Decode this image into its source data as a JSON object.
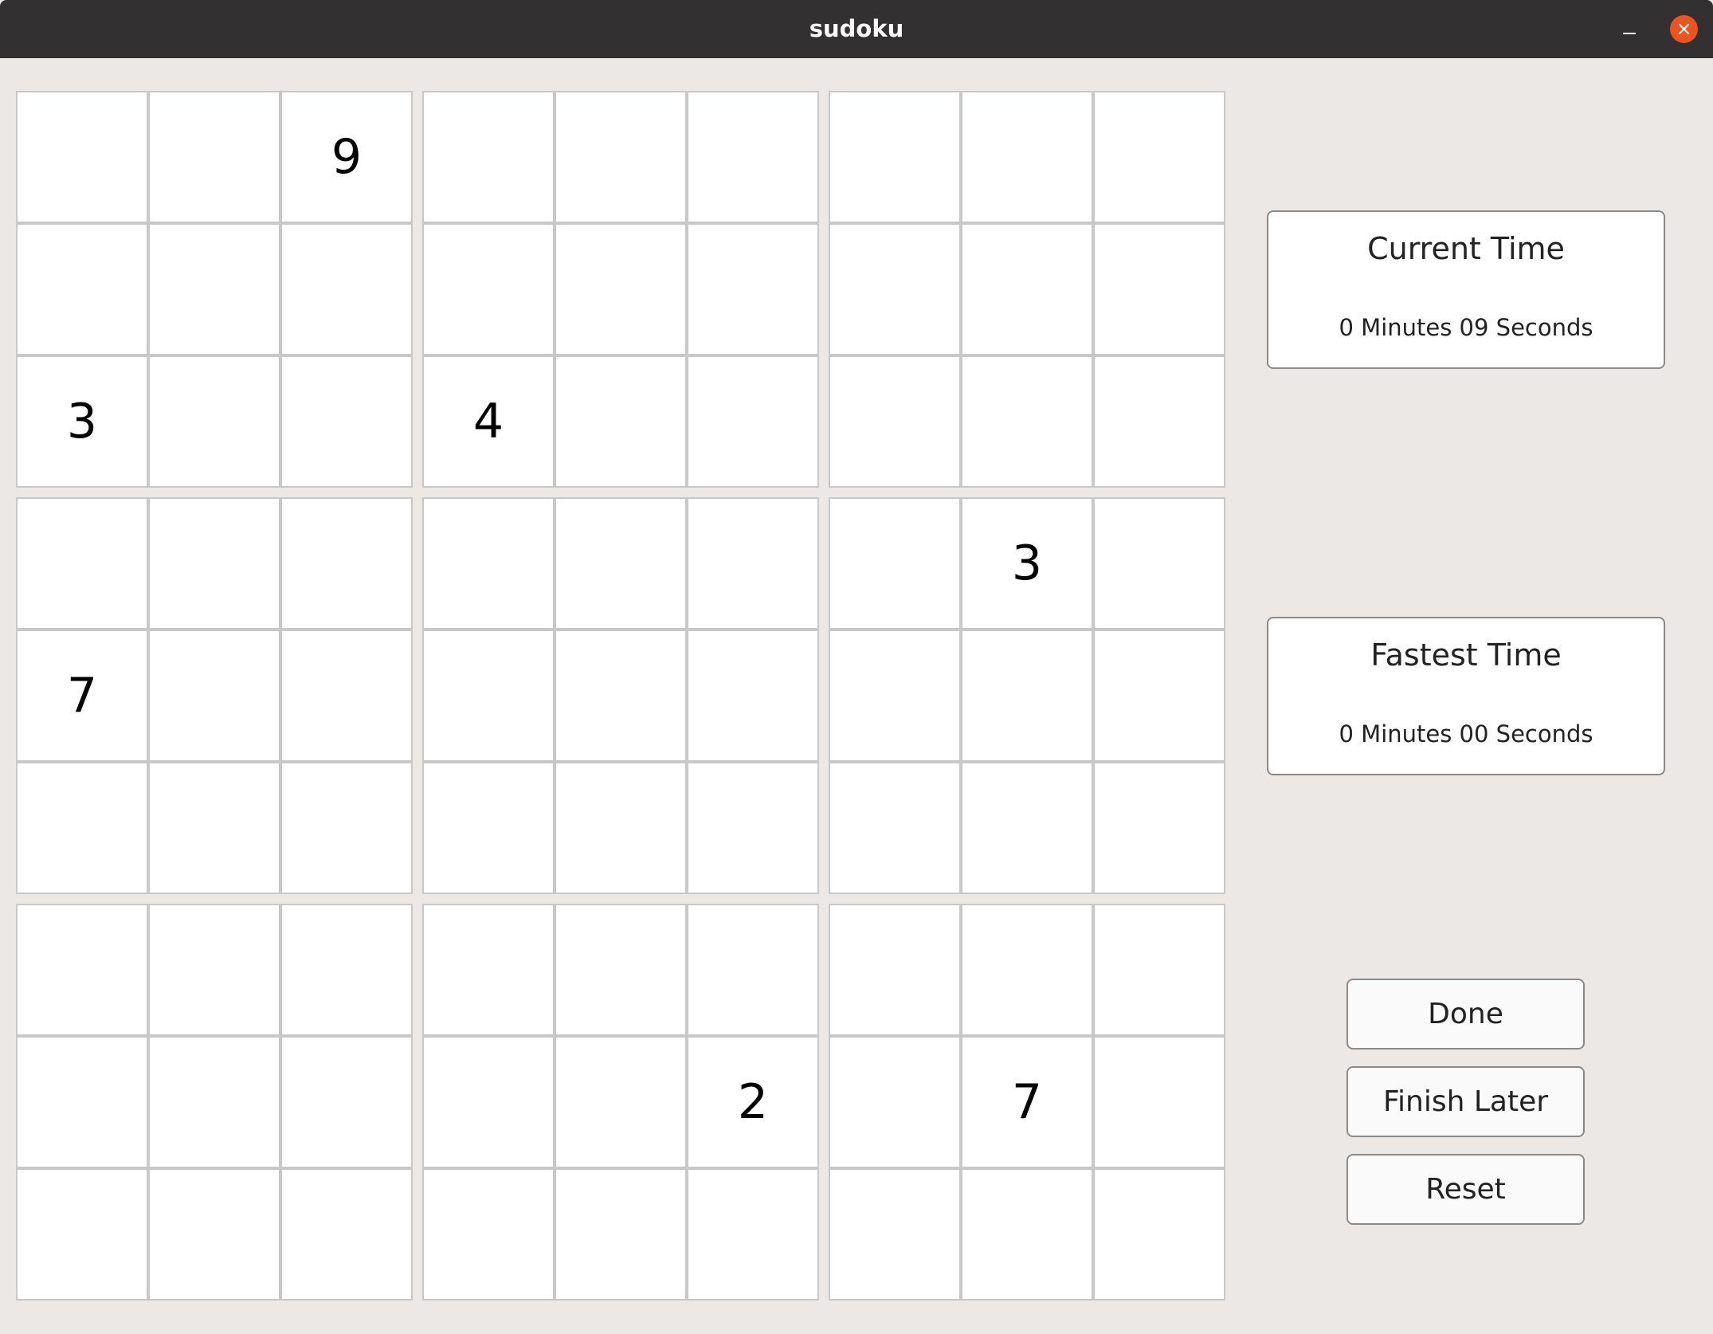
{
  "window": {
    "title": "sudoku",
    "close_symbol": "×",
    "minimize_icon": "minimize-icon",
    "close_icon": "close-icon",
    "accent_close_color": "#e95420"
  },
  "grid": [
    [
      "",
      "",
      "9",
      "",
      "",
      "",
      "",
      "",
      ""
    ],
    [
      "",
      "",
      "",
      "",
      "",
      "",
      "",
      "",
      ""
    ],
    [
      "3",
      "",
      "",
      "4",
      "",
      "",
      "",
      "",
      ""
    ],
    [
      "",
      "",
      "",
      "",
      "",
      "",
      "",
      "3",
      ""
    ],
    [
      "7",
      "",
      "",
      "",
      "",
      "",
      "",
      "",
      ""
    ],
    [
      "",
      "",
      "",
      "",
      "",
      "",
      "",
      "",
      ""
    ],
    [
      "",
      "",
      "",
      "",
      "",
      "",
      "",
      "",
      ""
    ],
    [
      "",
      "",
      "",
      "",
      "",
      "2",
      "",
      "7",
      ""
    ],
    [
      "",
      "",
      "",
      "",
      "",
      "",
      "",
      "",
      ""
    ]
  ],
  "current_time": {
    "label": "Current Time",
    "value": "0 Minutes 09 Seconds"
  },
  "fastest_time": {
    "label": "Fastest Time",
    "value": "0 Minutes 00 Seconds"
  },
  "buttons": {
    "done": "Done",
    "finish_later": "Finish Later",
    "reset": "Reset"
  }
}
